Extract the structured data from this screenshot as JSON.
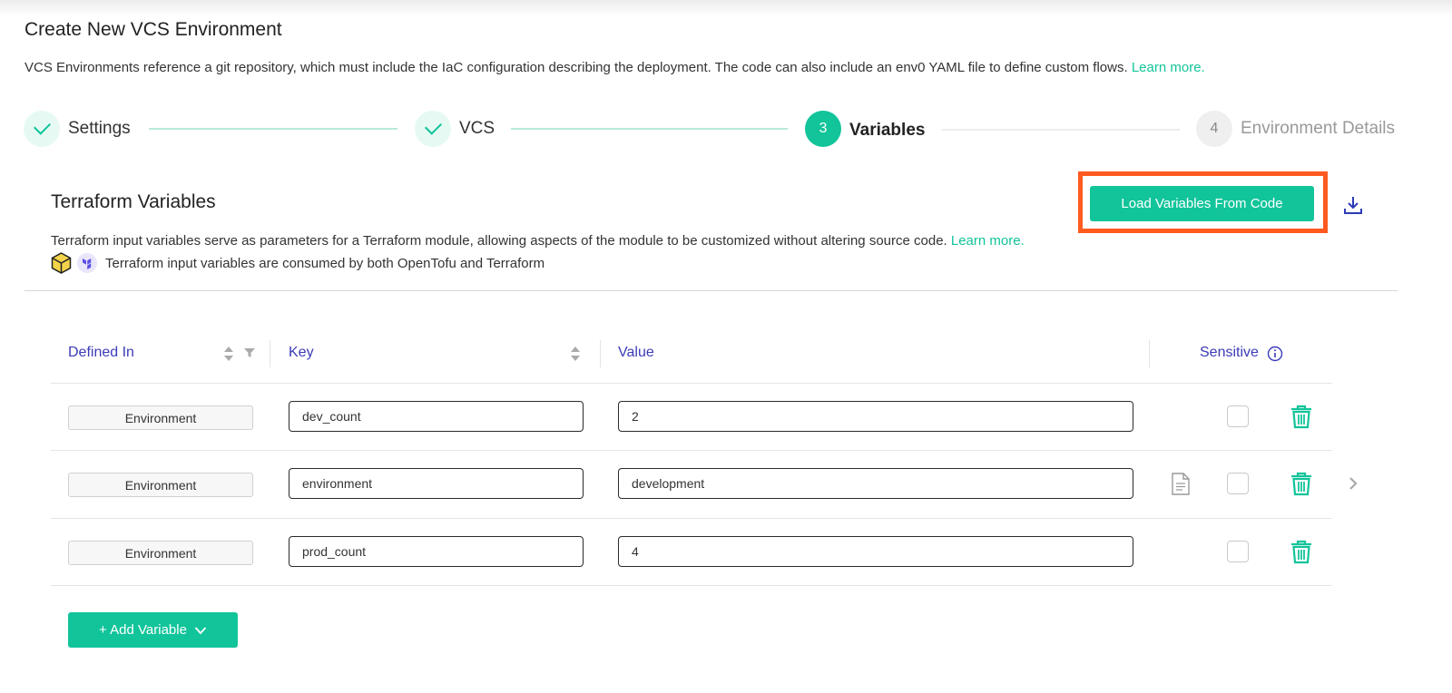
{
  "page": {
    "title": "Create New VCS Environment",
    "description": "VCS Environments reference a git repository, which must include the IaC configuration describing the deployment. The code can also include an env0 YAML file to define custom flows.",
    "learn_more": "Learn more."
  },
  "stepper": {
    "steps": [
      {
        "number": "",
        "label": "Settings",
        "state": "done"
      },
      {
        "number": "",
        "label": "VCS",
        "state": "done"
      },
      {
        "number": "3",
        "label": "Variables",
        "state": "active"
      },
      {
        "number": "4",
        "label": "Environment Details",
        "state": "todo"
      }
    ]
  },
  "section": {
    "title": "Terraform Variables",
    "load_button": "Load Variables From Code",
    "description": "Terraform input variables serve as parameters for a Terraform module, allowing aspects of the module to be customized without altering source code.",
    "learn_more": "Learn more.",
    "consumed_note": "Terraform input variables are consumed by both OpenTofu and Terraform"
  },
  "table": {
    "headers": {
      "defined_in": "Defined In",
      "key": "Key",
      "value": "Value",
      "sensitive": "Sensitive"
    },
    "rows": [
      {
        "defined_in": "Environment",
        "key": "dev_count",
        "value": "2",
        "sensitive": false
      },
      {
        "defined_in": "Environment",
        "key": "environment",
        "value": "development",
        "sensitive": false
      },
      {
        "defined_in": "Environment",
        "key": "prod_count",
        "value": "4",
        "sensitive": false
      }
    ]
  },
  "add_button": "+ Add Variable",
  "colors": {
    "accent": "#12c49a",
    "header_text": "#3b3bb8",
    "highlight": "#ff5a1f"
  },
  "icons": [
    "check-icon",
    "download-icon",
    "opentofu-logo-icon",
    "terraform-logo-icon",
    "sort-icon",
    "filter-icon",
    "info-icon",
    "file-icon",
    "trash-icon",
    "chevron-right-icon",
    "chevron-down-icon"
  ]
}
